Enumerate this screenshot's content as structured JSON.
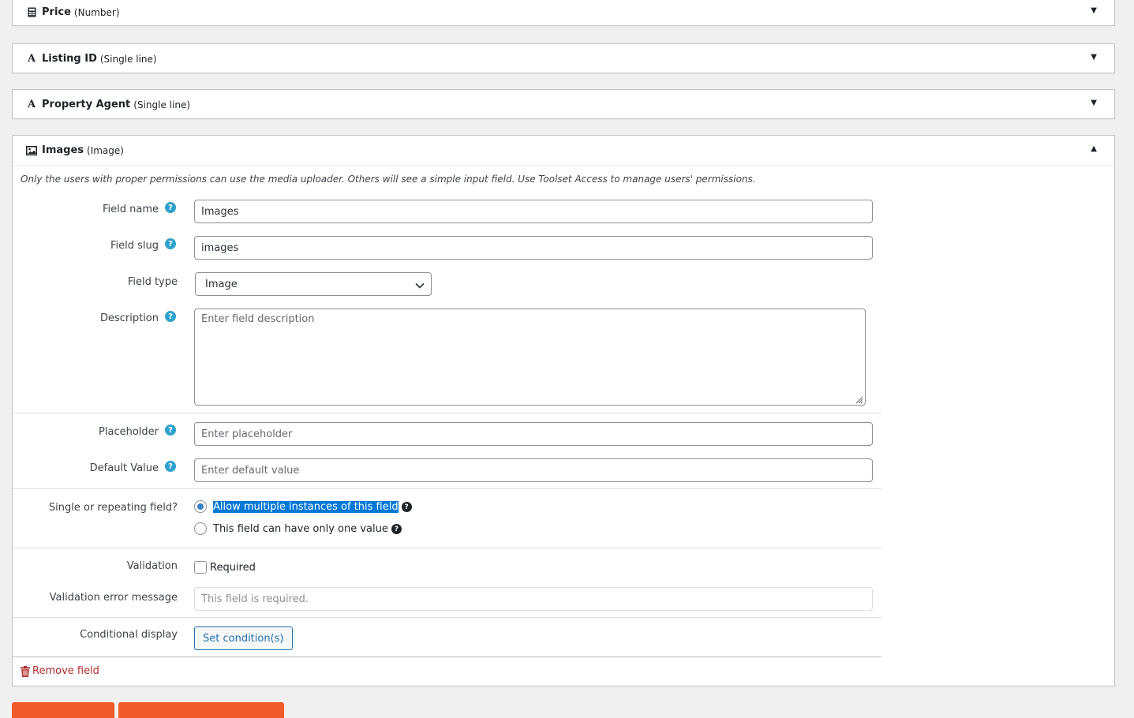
{
  "collapsed_fields": [
    {
      "title": "Price",
      "type": "(Number)",
      "icon": "calculator-icon"
    },
    {
      "title": "Listing ID",
      "type": "(Single line)",
      "icon": "text-a-icon"
    },
    {
      "title": "Property Agent",
      "type": "(Single line)",
      "icon": "text-a-icon"
    }
  ],
  "images_field": {
    "title": "Images",
    "type": "(Image)",
    "icon": "image-icon",
    "notice": "Only the users with proper permissions can use the media uploader. Others will see a simple input field. Use Toolset Access to manage users' permissions.",
    "field_name_label": "Field name",
    "field_name_value": "Images",
    "field_slug_label": "Field slug",
    "field_slug_value": "images",
    "field_type_label": "Field type",
    "field_type_value": "Image",
    "description_label": "Description",
    "description_placeholder": "Enter field description",
    "placeholder_label": "Placeholder",
    "placeholder_placeholder": "Enter placeholder",
    "default_value_label": "Default Value",
    "default_value_placeholder": "Enter default value",
    "repeat_label": "Single or repeating field?",
    "repeat_option_multiple": "Allow multiple instances of this field",
    "repeat_option_single": "This field can have only one value",
    "repeat_selected": "multiple",
    "validation_label": "Validation",
    "required_label": "Required",
    "required_checked": false,
    "validation_msg_label": "Validation error message",
    "validation_msg_placeholder": "This field is required.",
    "conditional_label": "Conditional display",
    "set_conditions_button": "Set condition(s)",
    "remove_field": "Remove field"
  },
  "colors": {
    "help": "#2ea2cc",
    "accent": "#2271b1",
    "danger": "#b32d2e",
    "orange": "#f05a28",
    "selection": "#0078d7"
  }
}
